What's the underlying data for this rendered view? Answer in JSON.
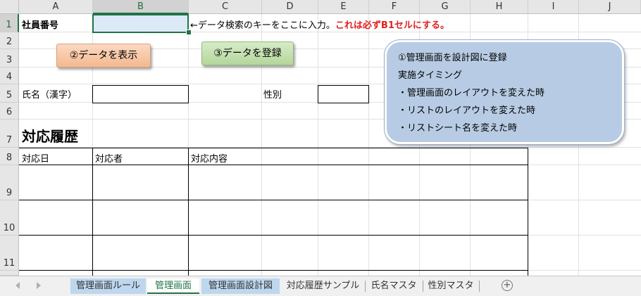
{
  "columns": [
    "A",
    "B",
    "C",
    "D",
    "E",
    "F",
    "G",
    "H",
    "I",
    "J"
  ],
  "rows": [
    "1",
    "2",
    "3",
    "4",
    "5",
    "6",
    "7",
    "8",
    "9",
    "10",
    "11"
  ],
  "cells": {
    "a1": "社員番号",
    "c1_note": "←データ検索のキーをここに入力。",
    "c1_warning": "これは必ずB1セルにする。",
    "a5": "氏名（漢字）",
    "d5": "性別",
    "a7": "対応履歴",
    "a8": "対応日",
    "b8": "対応者",
    "c8": "対応内容"
  },
  "buttons": {
    "show_data": "②データを表示",
    "register_data": "③データを登録"
  },
  "callout": {
    "title": "①管理画面を設計図に登録",
    "subtitle": "実施タイミング",
    "items": [
      "・管理画面のレイアウトを変えた時",
      "・リストのレイアウトを変えた時",
      "・リストシート名を変えた時"
    ]
  },
  "sheet_tabs": [
    "管理画面ルール",
    "管理画面",
    "管理画面設計図",
    "対応履歴サンプル",
    "氏名マスタ",
    "性別マスタ"
  ],
  "active_tab": "管理画面",
  "colors": {
    "accent_green": "#217346",
    "warning_red": "#e02020",
    "show_button": "#f8cbad",
    "register_button": "#c6e0b4",
    "callout_bg": "#b7cce4",
    "tab_highlight": "#bdd7ee",
    "selected_cell": "#dce9f6"
  },
  "icons": {
    "scroll_left": "triangle-left-icon",
    "scroll_right": "triangle-right-icon",
    "add_sheet": "plus-circle-icon"
  }
}
